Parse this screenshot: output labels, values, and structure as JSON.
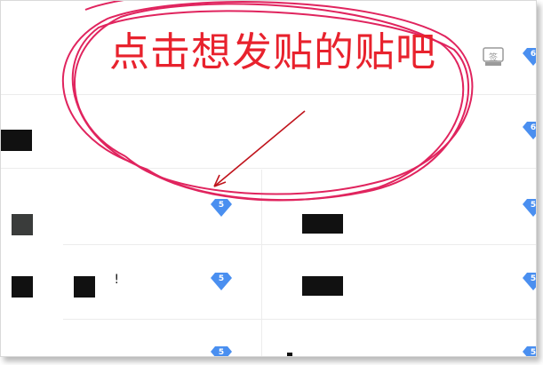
{
  "annotation": {
    "text": "点击想发贴的贴吧",
    "color": "#e8222d"
  },
  "header": {
    "sign_icon_label": "签"
  },
  "badge_color": "#4a8ff0",
  "badges": {
    "right_row1": "6",
    "right_row2": "6",
    "left_row3": "5",
    "right_row3": "5",
    "left_row4": "5",
    "right_row4": "5",
    "left_row5": "5",
    "right_row5": "5"
  },
  "glyphs": {
    "row4_mark": "!"
  }
}
